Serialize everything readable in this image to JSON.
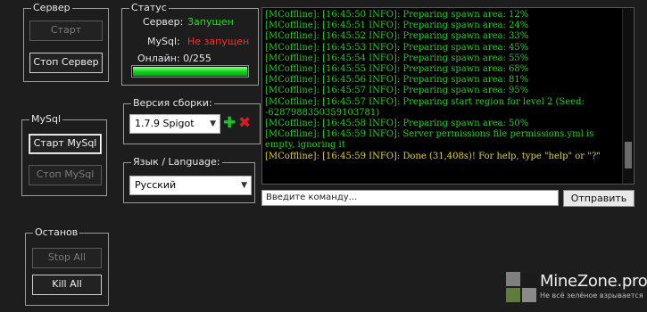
{
  "server_group": {
    "title": "Сервер",
    "start_label": "Старт",
    "stop_label": "Стоп Сервер"
  },
  "status_group": {
    "title": "Статус",
    "server_label": "Сервер:",
    "server_value": "Запущен",
    "mysql_label": "MySql:",
    "mysql_value": "Не запущен",
    "online_text": "Онлайн: 0/255",
    "progress_fraction": 1.0
  },
  "build_group": {
    "title": "Версия сборки:",
    "selected": "1.7.9 Spigot",
    "add_icon": "plus-icon",
    "remove_icon": "close-icon"
  },
  "language_group": {
    "title": "Язык / Language:",
    "selected": "Русский"
  },
  "mysql_group": {
    "title": "MySql",
    "start_label": "Старт MySql",
    "stop_label": "Стоп MySql"
  },
  "shutdown_group": {
    "title": "Останов",
    "stop_all_label": "Stop All",
    "kill_all_label": "Kill All"
  },
  "console": {
    "lines": [
      {
        "text": "[MCoffline]: [16:45:50 INFO]: Preparing spawn area: 12%",
        "color": "green"
      },
      {
        "text": "[MCoffline]: [16:45:51 INFO]: Preparing spawn area: 24%",
        "color": "green"
      },
      {
        "text": "[MCoffline]: [16:45:52 INFO]: Preparing spawn area: 33%",
        "color": "green"
      },
      {
        "text": "[MCoffline]: [16:45:53 INFO]: Preparing spawn area: 45%",
        "color": "green"
      },
      {
        "text": "[MCoffline]: [16:45:54 INFO]: Preparing spawn area: 55%",
        "color": "green"
      },
      {
        "text": "[MCoffline]: [16:45:55 INFO]: Preparing spawn area: 68%",
        "color": "green"
      },
      {
        "text": "[MCoffline]: [16:45:56 INFO]: Preparing spawn area: 81%",
        "color": "green"
      },
      {
        "text": "[MCoffline]: [16:45:57 INFO]: Preparing spawn area: 95%",
        "color": "green"
      },
      {
        "text": "[MCoffline]: [16:45:57 INFO]: Preparing start region for level 2 (Seed: -6287988350359103781)",
        "color": "green"
      },
      {
        "text": "[MCoffline]: [16:45:58 INFO]: Preparing spawn area: 50%",
        "color": "green"
      },
      {
        "text": "[MCoffline]: [16:45:59 INFO]: Server permissions file permissions.yml is empty, ignoring it",
        "color": "green"
      },
      {
        "text": "[MCoffline]: [16:45:59 INFO]: Done (31,408s)! For help, type \"help\" or \"?\"",
        "color": "yellow"
      }
    ]
  },
  "command": {
    "placeholder": "Введите команду...",
    "send_label": "Отправить"
  },
  "watermark": {
    "title": "MineZone.pro",
    "subtitle": "Не всё зелёное взрывается"
  },
  "colors": {
    "running": "#19e020",
    "not_running": "#ff2a2a",
    "log_green": "#1fd11f",
    "log_yellow": "#e6d21e"
  }
}
